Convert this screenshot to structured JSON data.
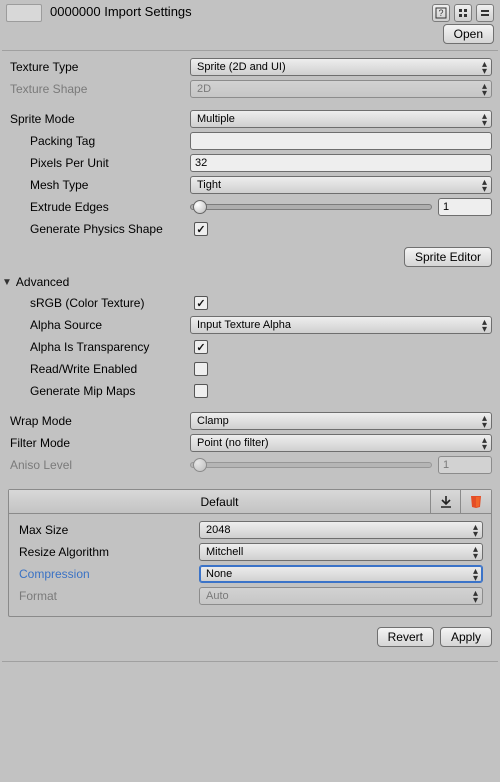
{
  "header": {
    "title": "0000000 Import Settings",
    "open_label": "Open"
  },
  "texture": {
    "type_label": "Texture Type",
    "type_value": "Sprite (2D and UI)",
    "shape_label": "Texture Shape",
    "shape_value": "2D"
  },
  "sprite": {
    "mode_label": "Sprite Mode",
    "mode_value": "Multiple",
    "packing_label": "Packing Tag",
    "packing_value": "",
    "ppu_label": "Pixels Per Unit",
    "ppu_value": "32",
    "meshtype_label": "Mesh Type",
    "meshtype_value": "Tight",
    "extrude_label": "Extrude Edges",
    "extrude_value": "1",
    "physics_label": "Generate Physics Shape",
    "sprite_editor_label": "Sprite Editor"
  },
  "advanced": {
    "title": "Advanced",
    "srgb_label": "sRGB (Color Texture)",
    "alpha_src_label": "Alpha Source",
    "alpha_src_value": "Input Texture Alpha",
    "alpha_trans_label": "Alpha Is Transparency",
    "rw_label": "Read/Write Enabled",
    "mip_label": "Generate Mip Maps"
  },
  "sampling": {
    "wrap_label": "Wrap Mode",
    "wrap_value": "Clamp",
    "filter_label": "Filter Mode",
    "filter_value": "Point (no filter)",
    "aniso_label": "Aniso Level",
    "aniso_value": "1"
  },
  "platform": {
    "default_tab": "Default",
    "maxsize_label": "Max Size",
    "maxsize_value": "2048",
    "resize_label": "Resize Algorithm",
    "resize_value": "Mitchell",
    "compression_label": "Compression",
    "compression_value": "None",
    "format_label": "Format",
    "format_value": "Auto"
  },
  "buttons": {
    "revert": "Revert",
    "apply": "Apply"
  }
}
